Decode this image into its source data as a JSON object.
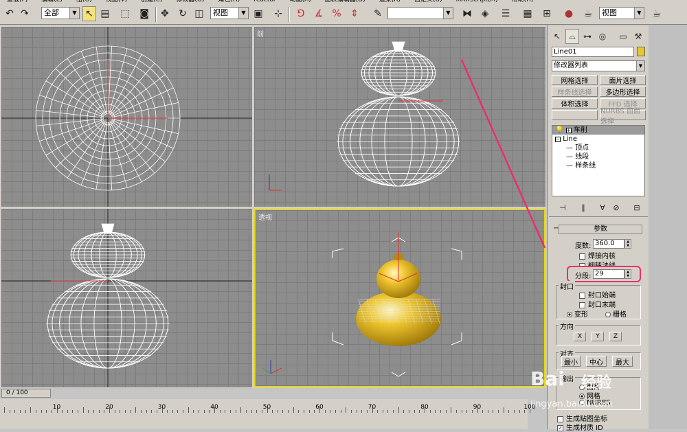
{
  "menubar": {
    "items": [
      "重载(F)",
      "编辑(E)",
      "组(G)",
      "视图(V)",
      "创建(C)",
      "修改器(O)",
      "角色(H)",
      "reactor",
      "动画(A)",
      "图表编辑器(D)",
      "渲染(R)",
      "自定义(U)",
      "MAXScript(M)",
      "帮助(H)"
    ]
  },
  "toolbar": {
    "selection_filter": "全部",
    "ref_coord": "视图",
    "named_selection": "",
    "render_view": "视图"
  },
  "viewports": {
    "top_label": "",
    "front_label": "前",
    "left_label": "",
    "perspective_label": "透视"
  },
  "command_panel": {
    "object_name": "Line01",
    "modifier_list": "修改器列表",
    "buttons": [
      {
        "label": "网格选择",
        "disabled": false
      },
      {
        "label": "面片选择",
        "disabled": false
      },
      {
        "label": "样条线选择",
        "disabled": true
      },
      {
        "label": "多边形选择",
        "disabled": false
      },
      {
        "label": "体积选择",
        "disabled": false
      },
      {
        "label": "FFD 选择",
        "disabled": true
      },
      {
        "label": "",
        "disabled": true
      },
      {
        "label": "NURBS 曲面选择",
        "disabled": true
      }
    ],
    "stack": {
      "modifier": "车削",
      "base": "Line",
      "subs": [
        "顶点",
        "线段",
        "样条线"
      ]
    },
    "rollout_title": "参数",
    "degrees_label": "度数:",
    "degrees_value": "360.0",
    "weld_core": "焊接内核",
    "flip_normals": "翻转法线",
    "segments_label": "分段:",
    "segments_value": "29",
    "capping_title": "封口",
    "cap_start": "封口始端",
    "cap_end": "封口末端",
    "morph": "变形",
    "grid": "栅格",
    "direction_title": "方向",
    "dir_x": "X",
    "dir_y": "Y",
    "dir_z": "Z",
    "align_title": "对齐",
    "align_min": "最小",
    "align_center": "中心",
    "align_max": "最大",
    "output_title": "输出",
    "output_patch": "面片",
    "output_mesh": "网格",
    "output_nurbs": "NURBS",
    "gen_mapping": "生成贴图坐标",
    "gen_mat_ids": "生成材质 ID"
  },
  "timeline": {
    "slider": "0 / 100",
    "ruler_labels": [
      "10",
      "20",
      "30",
      "40",
      "50",
      "60",
      "70",
      "80",
      "90",
      "100"
    ]
  },
  "watermark": {
    "brand": "Bai",
    "brand_cn": "经验",
    "url": "jingyan.baidu.com"
  },
  "colors": {
    "viewport_bg": "#8d8d8d",
    "active_border": "#e6d800",
    "annotation": "#e8306a",
    "object_yellow": "#f0c830"
  }
}
